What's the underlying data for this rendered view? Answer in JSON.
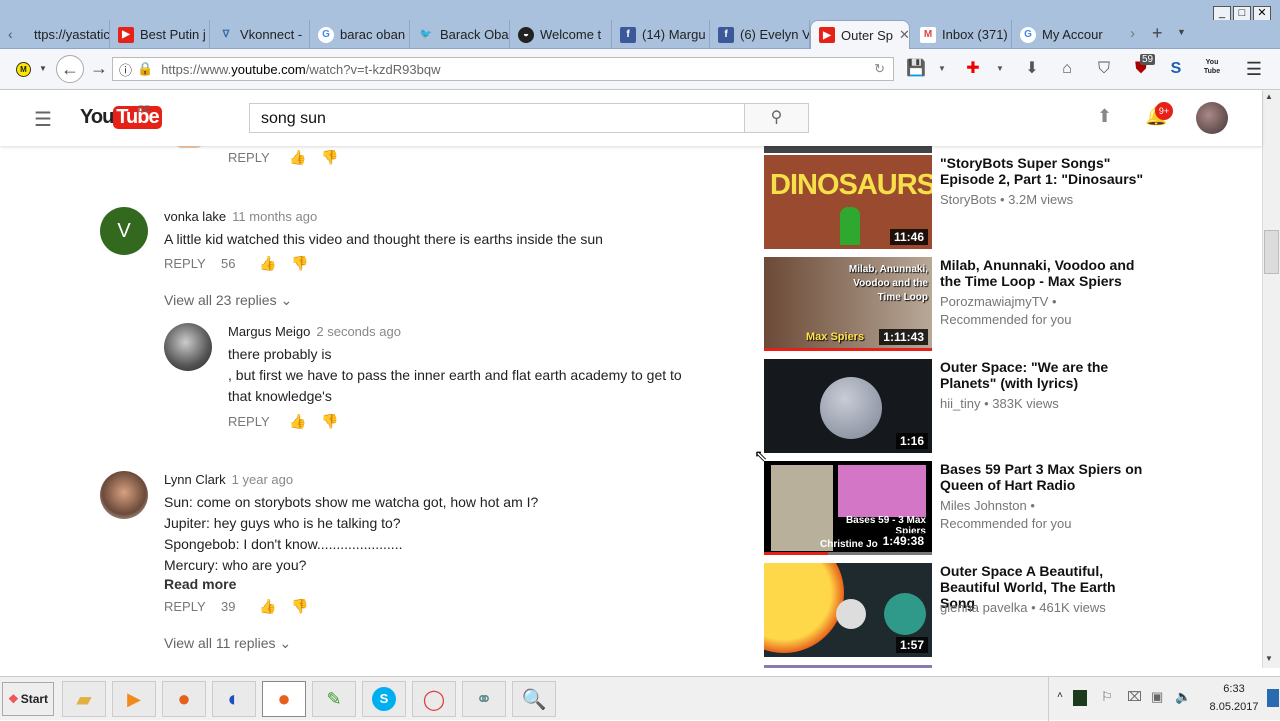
{
  "browser": {
    "tabs": [
      {
        "label": "ttps://yastatic",
        "icon": "none"
      },
      {
        "label": "Best Putin j",
        "icon": "youtube-icon"
      },
      {
        "label": "Vkonnect -",
        "icon": "vkonnect-icon"
      },
      {
        "label": "barac oban",
        "icon": "google-icon"
      },
      {
        "label": "Barack Oba",
        "icon": "twitter-icon"
      },
      {
        "label": "Welcome t",
        "icon": "obama-icon"
      },
      {
        "label": "(14) Margu",
        "icon": "facebook-icon"
      },
      {
        "label": "(6) Evelyn V",
        "icon": "facebook-icon"
      },
      {
        "label": "Outer Sp",
        "icon": "youtube-icon",
        "active": true
      },
      {
        "label": "Inbox (371)",
        "icon": "gmail-icon"
      },
      {
        "label": "My Accour",
        "icon": "google-icon"
      }
    ],
    "url_prefix": "https://www.",
    "url_domain": "youtube.com",
    "url_rest": "/watch?v=t-kzdR93bqw",
    "badge_count": "59",
    "youtube_ext_label": "You Tube"
  },
  "youtube": {
    "logo": "YouTube",
    "country": "EE",
    "search_value": "song sun",
    "notif_count": "9+"
  },
  "comments": {
    "reply_label": "REPLY",
    "read_more": "Read more",
    "items": [
      {
        "author": "vonka lake",
        "initial": "V",
        "time": "11 months ago",
        "text": [
          "A little kid watched this video and thought there is earths inside the sun"
        ],
        "likes": "56",
        "view_replies": "View all 23 replies"
      },
      {
        "author": "Margus Meigo",
        "time": "2 seconds ago",
        "text": [
          "there probably is",
          ", but first we have to pass the inner earth and flat earth academy to get to",
          "that knowledge's"
        ]
      },
      {
        "author": "Lynn Clark",
        "time": "1 year ago",
        "text": [
          "Sun: come on storybots show me watcha got, how hot am I?",
          "Jupiter: hey guys who is he talking to?",
          "Spongebob: I don't know......................",
          "Mercury: who are you?"
        ],
        "likes": "39",
        "view_replies": "View all 11 replies"
      }
    ]
  },
  "recommended": [
    {
      "title": "\"StoryBots Super Songs\" Episode 2, Part 1: \"Dinosaurs\"",
      "channel": "StoryBots",
      "meta": "3.2M views",
      "duration": "11:46",
      "thumb_text": "DINOSAURS"
    },
    {
      "title": "Milab, Anunnaki, Voodoo and the Time Loop - Max Spiers",
      "channel": "PorozmawiajmyTV",
      "meta": "Recommended for you",
      "duration": "1:11:43",
      "thumb_text": "Milab, Anunnaki, Voodoo and the Time Loop",
      "thumb_sub": "Max Spiers"
    },
    {
      "title": "Outer Space: \"We are the Planets\" (with lyrics)",
      "channel": "hii_tiny",
      "meta": "383K views",
      "duration": "1:16"
    },
    {
      "title": "Bases 59 Part 3 Max Spiers on Queen of Hart Radio",
      "channel": "Miles Johnston",
      "meta": "Recommended for you",
      "duration": "1:49:38",
      "thumb_text": "Bases 59 - 3 Max Spiers",
      "thumb_sub": "Christine Jo"
    },
    {
      "title": "Outer Space A Beautiful, Beautiful World, The Earth Song",
      "channel": "glenna pavelka",
      "meta": "461K views",
      "duration": "1:57"
    }
  ],
  "taskbar": {
    "start": "Start",
    "time": "6:33",
    "date": "8.05.2017"
  },
  "colors": {
    "youtube_red": "#e62117",
    "avatar_green": "#33691e",
    "tab_bar": "#a9c1dd"
  }
}
